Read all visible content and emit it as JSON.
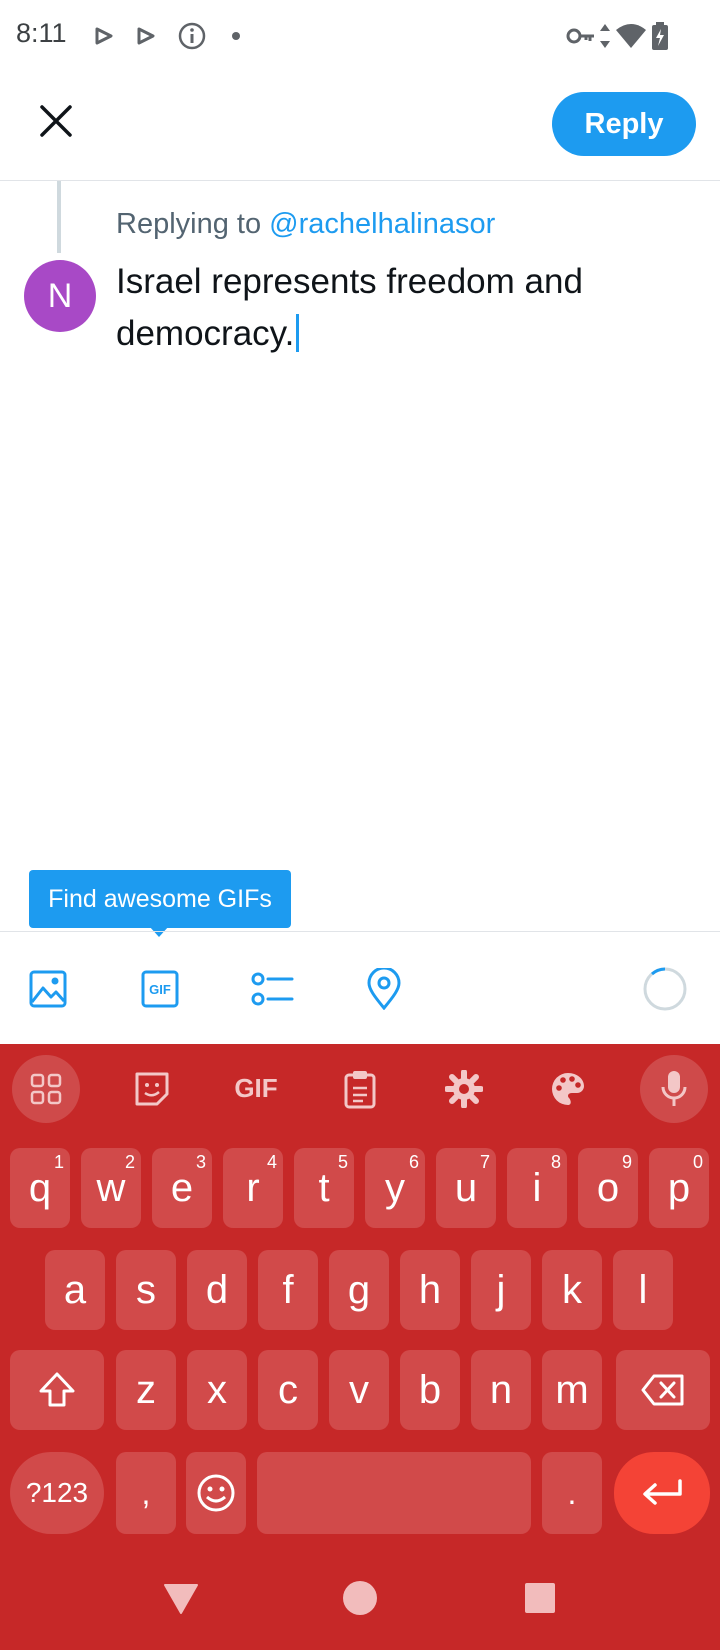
{
  "status_bar": {
    "time": "8:11"
  },
  "header": {
    "reply_label": "Reply"
  },
  "compose": {
    "replying_prefix": "Replying to",
    "replying_handle": "@rachelhalinasor",
    "avatar_initial": "N",
    "text": "Israel represents freedom and democracy."
  },
  "tooltip": {
    "text": "Find awesome GIFs"
  },
  "toolbar": {
    "gif_label": "GIF"
  },
  "keyboard": {
    "toolbar_gif": "GIF",
    "row1": [
      {
        "key": "q",
        "hint": "1"
      },
      {
        "key": "w",
        "hint": "2"
      },
      {
        "key": "e",
        "hint": "3"
      },
      {
        "key": "r",
        "hint": "4"
      },
      {
        "key": "t",
        "hint": "5"
      },
      {
        "key": "y",
        "hint": "6"
      },
      {
        "key": "u",
        "hint": "7"
      },
      {
        "key": "i",
        "hint": "8"
      },
      {
        "key": "o",
        "hint": "9"
      },
      {
        "key": "p",
        "hint": "0"
      }
    ],
    "row2": [
      "a",
      "s",
      "d",
      "f",
      "g",
      "h",
      "j",
      "k",
      "l"
    ],
    "row3": [
      "z",
      "x",
      "c",
      "v",
      "b",
      "n",
      "m"
    ],
    "symbols_label": "?123",
    "comma": ",",
    "period": "."
  },
  "colors": {
    "accent": "#1d9bf0",
    "keyboard_bg": "#c62828",
    "avatar": "#a849c6",
    "enter": "#f44336"
  }
}
